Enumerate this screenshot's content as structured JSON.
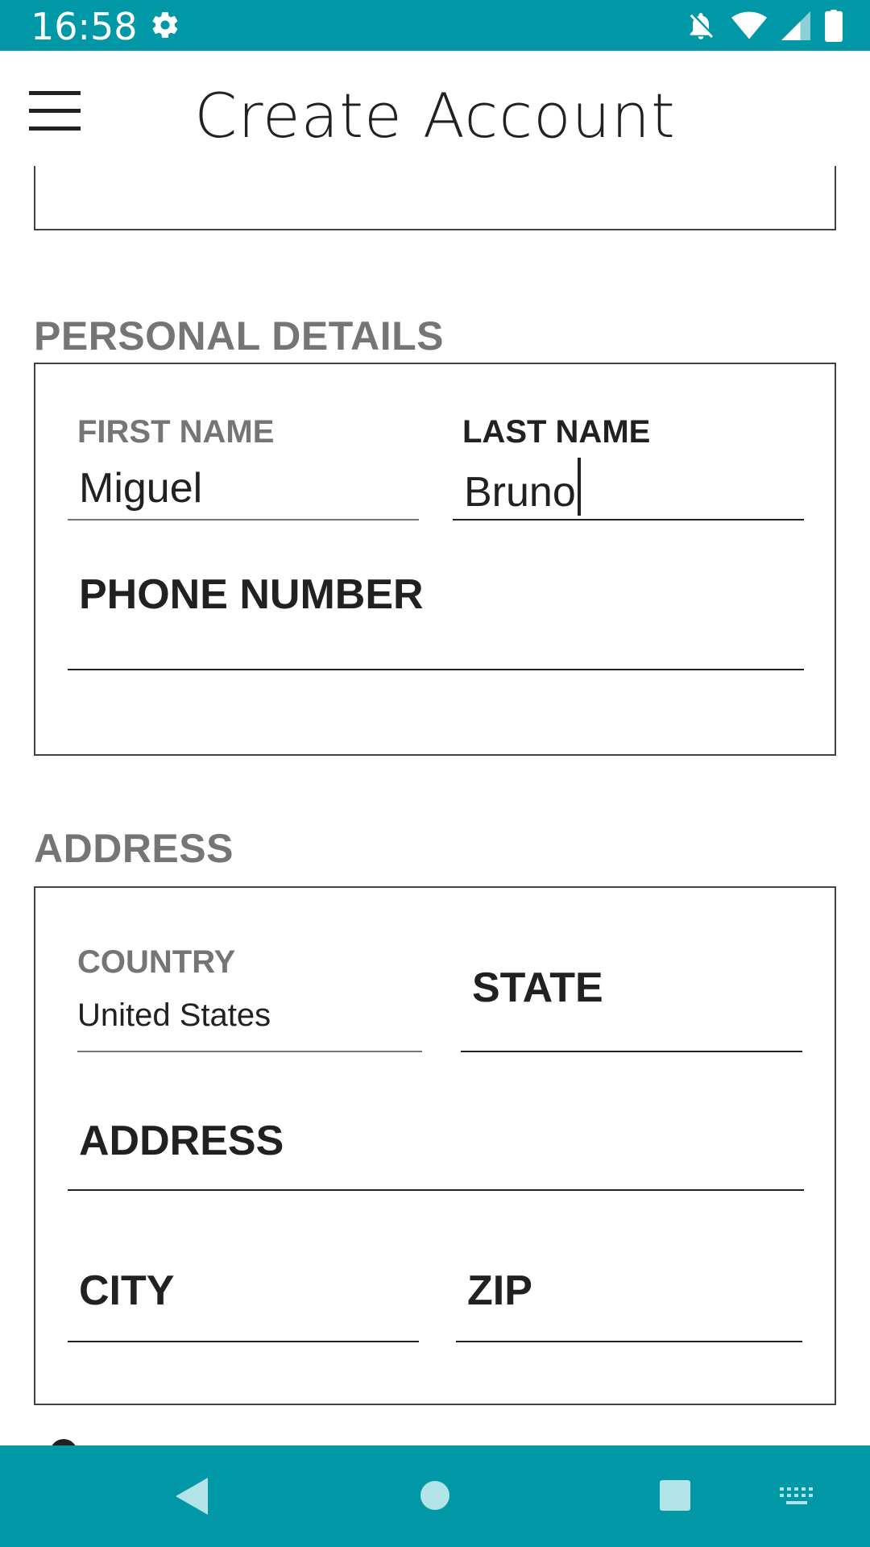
{
  "status_bar": {
    "time": "16:58",
    "icons": [
      "settings-icon",
      "notifications-off-icon",
      "wifi-icon",
      "signal-icon",
      "battery-icon"
    ]
  },
  "app_bar": {
    "title": "Create Account",
    "menu_icon": "hamburger-menu-icon"
  },
  "personal_details": {
    "section_title": "PERSONAL DETAILS",
    "first_name": {
      "label": "FIRST NAME",
      "value": "Miguel"
    },
    "last_name": {
      "label": "LAST NAME",
      "value": "Bruno"
    },
    "phone_number": {
      "placeholder": "PHONE NUMBER"
    }
  },
  "address_section": {
    "section_title": "ADDRESS",
    "country": {
      "label": "COUNTRY",
      "value": "United States"
    },
    "state": {
      "placeholder": "STATE"
    },
    "address": {
      "placeholder": "ADDRESS"
    },
    "city": {
      "placeholder": "CITY"
    },
    "zip": {
      "placeholder": "ZIP"
    }
  },
  "nav_bar": {
    "icons": [
      "back-icon",
      "home-icon",
      "recents-icon",
      "keyboard-icon"
    ]
  },
  "colors": {
    "system_bar": "#0097a7",
    "section_title": "#757575",
    "text": "#212121"
  }
}
